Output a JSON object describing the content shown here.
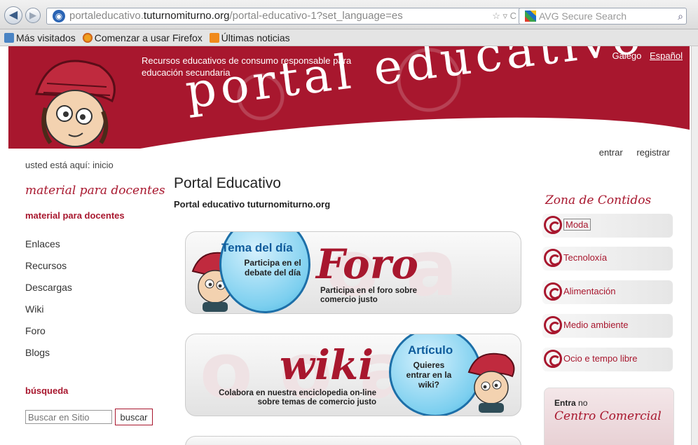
{
  "browser": {
    "url_prefix": "portaleducativo.",
    "url_host": "tuturnomiturno.org",
    "url_path": "/portal-educativo-1?set_language=es",
    "search_placeholder": "AVG Secure Search",
    "bookmarks": [
      "Más visitados",
      "Comenzar a usar Firefox",
      "Últimas noticias"
    ]
  },
  "header": {
    "tagline": "Recursos educativos de consumo responsable para educación secundaria",
    "logo_text": "portal educativo",
    "languages": [
      "Galego",
      "Español"
    ],
    "active_language": "Español"
  },
  "user_links": {
    "login": "entrar",
    "register": "registrar"
  },
  "breadcrumb": "usted está aquí: inicio",
  "sidebar": {
    "title": "material para docentes",
    "heading": "material para docentes",
    "items": [
      "Enlaces",
      "Recursos",
      "Descargas",
      "Wiki",
      "Foro",
      "Blogs"
    ],
    "search_heading": "búsqueda",
    "search_placeholder": "Buscar en Sitio",
    "search_button": "buscar"
  },
  "main": {
    "title": "Portal Educativo",
    "subtitle": "Portal educativo tuturnomiturno.org",
    "foro_banner": {
      "bubble_title": "Tema del día",
      "bubble_text": "Participa en el debate del día",
      "word": "Foro",
      "caption": "Participa en el foro sobre comercio justo"
    },
    "wiki_banner": {
      "bubble_title": "Artículo",
      "bubble_text": "Quieres entrar en la wiki?",
      "word": "wiki",
      "caption": "Colabora en nuestra enciclopedia on-line sobre temas de comercio justo"
    }
  },
  "zona": {
    "title": "Zona de Contidos",
    "items": [
      "Moda",
      "Tecnoloxía",
      "Alimentación",
      "Medio ambiente",
      "Ocio e tempo libre"
    ]
  },
  "centro_comercial": {
    "intro_bold": "Entra",
    "intro_rest": " no",
    "name": "Centro Comercial"
  },
  "colors": {
    "brand": "#a8172e",
    "bubble_border": "#1d6fa8"
  }
}
